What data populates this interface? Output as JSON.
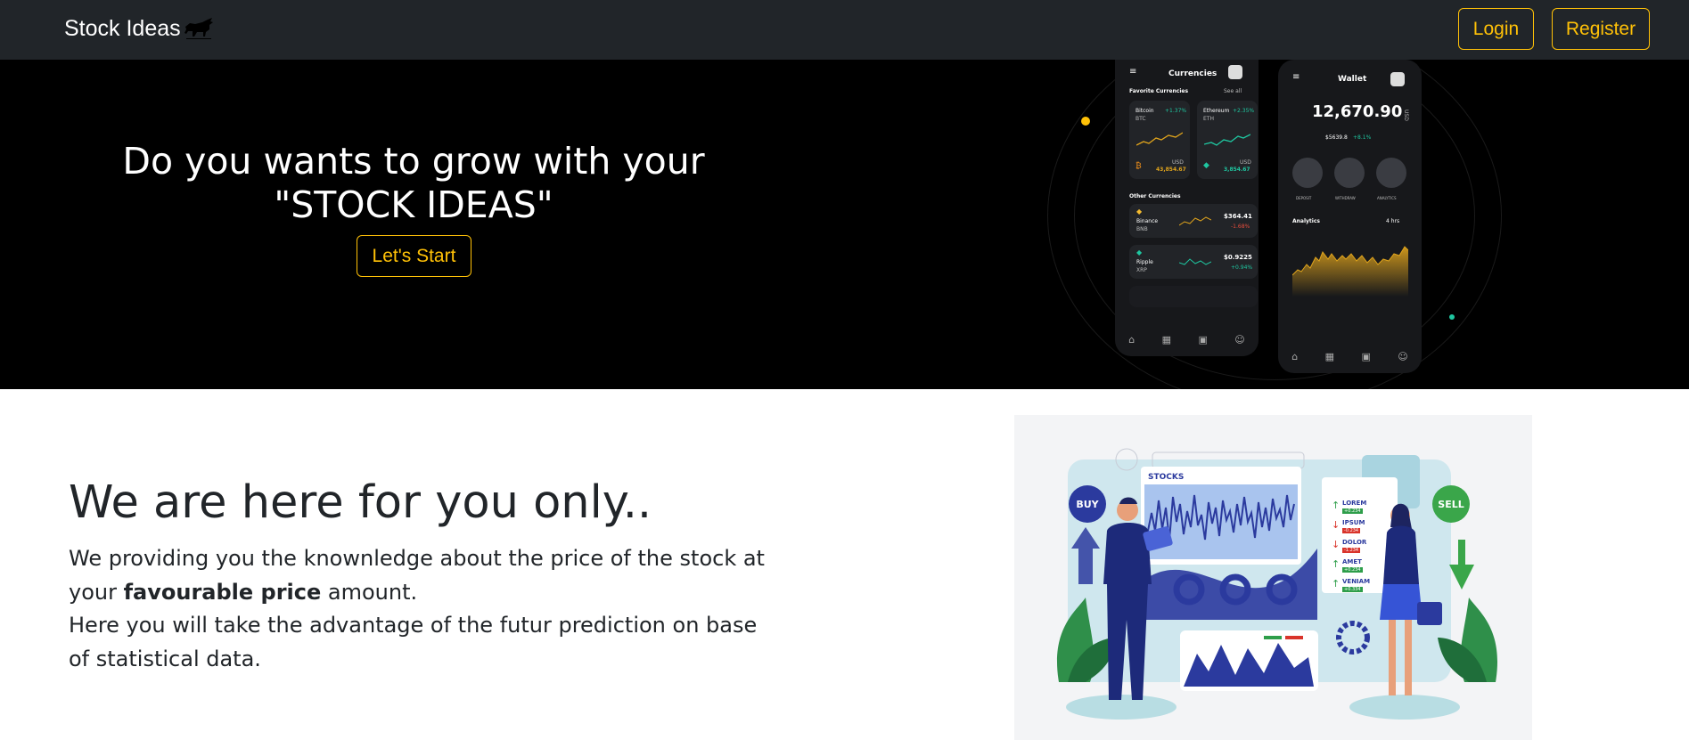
{
  "navbar": {
    "brand": "Stock Ideas",
    "login_label": "Login",
    "register_label": "Register"
  },
  "hero": {
    "title_line1": "Do you wants to grow with your",
    "title_line2": "\"STOCK IDEAS\"",
    "cta_label": "Let's Start"
  },
  "phone_left": {
    "title": "Currencies",
    "favorites_label": "Favorite Currencies",
    "see_all": "See all",
    "fav_cards": [
      {
        "name": "Bitcoin",
        "ticker": "BTC",
        "change": "+1.37%",
        "price": "43,854.67",
        "currency": "USD"
      },
      {
        "name": "Ethereum",
        "ticker": "ETH",
        "change": "+2.35%",
        "price": "3,854.67",
        "currency": "USD"
      }
    ],
    "other_label": "Other Currencies",
    "other_rows": [
      {
        "name": "Binance",
        "ticker": "BNB",
        "price": "$364.41",
        "change": "-1.68%"
      },
      {
        "name": "Ripple",
        "ticker": "XRP",
        "price": "$0.9225",
        "change": "+0.94%"
      }
    ]
  },
  "phone_right": {
    "title": "Wallet",
    "balance": "12,670.90",
    "balance_currency": "USD",
    "sub_balance": "$5639.8",
    "sub_change": "+8.1%",
    "actions": [
      "DEPOSIT",
      "WITHDRAW",
      "ANALYTICS"
    ],
    "analytics_label": "Analytics",
    "range_label": "4 hrs"
  },
  "about": {
    "title": "We are here for you only..",
    "para1_before": "We providing you the knownledge about the price of the stock at your ",
    "para1_bold": "favourable price",
    "para1_after": " amount.",
    "para2": "Here you will take the advantage of the futur prediction on base of statistical data."
  },
  "illustration": {
    "buy": "BUY",
    "sell": "SELL",
    "stocks": "STOCKS",
    "list": [
      {
        "label": "LOREM",
        "value": "+0.234",
        "dir": "up"
      },
      {
        "label": "IPSUM",
        "value": "-0.234",
        "dir": "down"
      },
      {
        "label": "DOLOR",
        "value": "-1.234",
        "dir": "down"
      },
      {
        "label": "AMET",
        "value": "+0.234",
        "dir": "up"
      },
      {
        "label": "VENIAM",
        "value": "+0.334",
        "dir": "up"
      }
    ]
  },
  "colors": {
    "navbar": "#212529",
    "accent": "#ffc107",
    "hero_bg": "#000000",
    "up": "#2e9e4a",
    "down": "#d9342b",
    "primary_blue": "#2b3a9e"
  }
}
